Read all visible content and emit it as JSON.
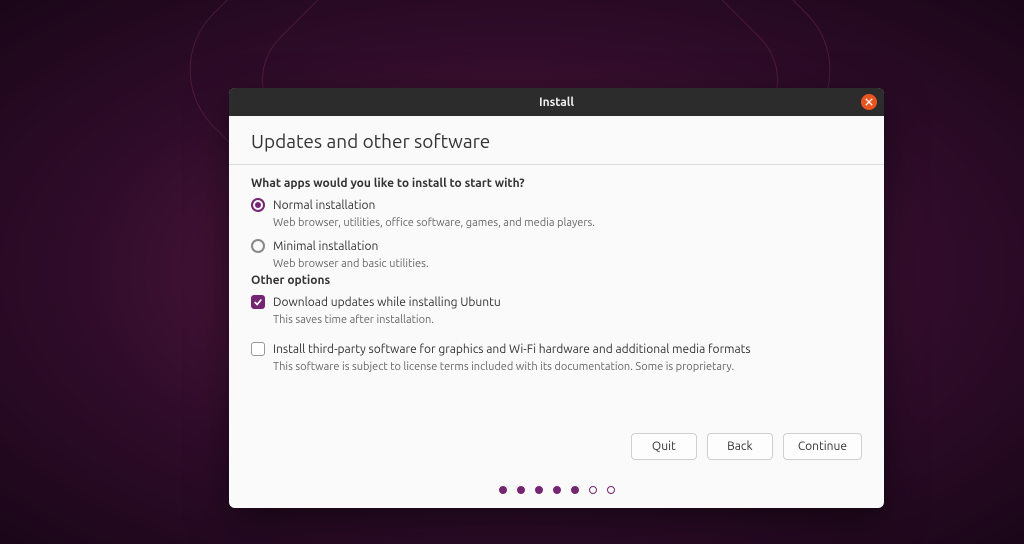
{
  "window": {
    "title": "Install"
  },
  "page": {
    "heading": "Updates and other software",
    "question": "What apps would you like to install to start with?",
    "options_heading": "Other options"
  },
  "install_type": {
    "normal": {
      "label": "Normal installation",
      "desc": "Web browser, utilities, office software, games, and media players.",
      "selected": true
    },
    "minimal": {
      "label": "Minimal installation",
      "desc": "Web browser and basic utilities.",
      "selected": false
    }
  },
  "other_options": {
    "download_updates": {
      "label": "Download updates while installing Ubuntu",
      "desc": "This saves time after installation.",
      "checked": true
    },
    "third_party": {
      "label": "Install third-party software for graphics and Wi-Fi hardware and additional media formats",
      "desc": "This software is subject to license terms included with its documentation. Some is proprietary.",
      "checked": false
    }
  },
  "buttons": {
    "quit": "Quit",
    "back": "Back",
    "continue": "Continue"
  },
  "progress": {
    "total": 7,
    "current": 5
  }
}
